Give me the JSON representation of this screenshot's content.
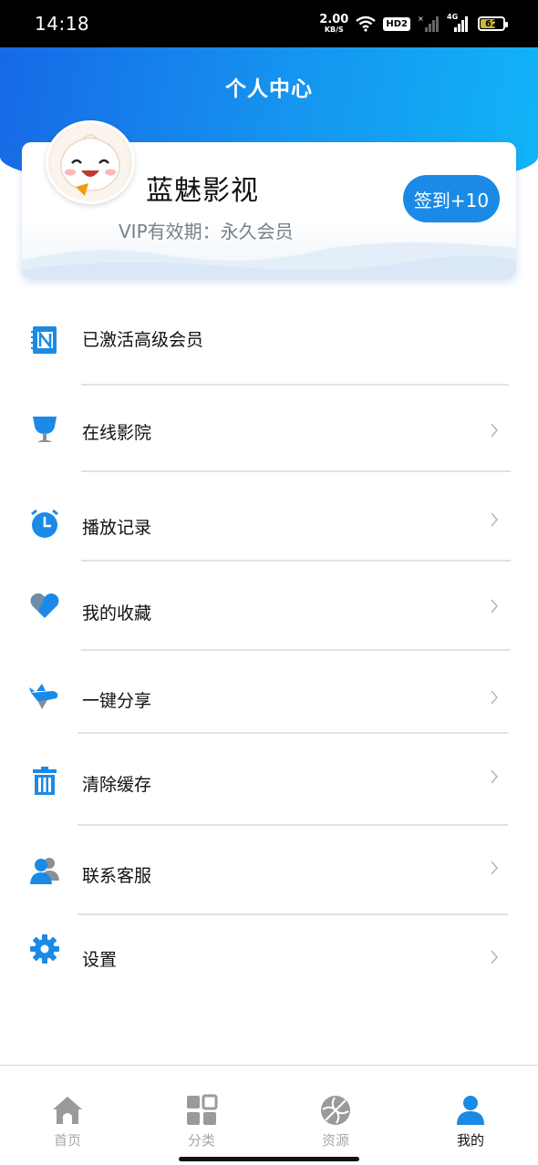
{
  "status_bar": {
    "time": "14:18",
    "net_speed": "2.00",
    "net_unit": "KB/S",
    "hd_label": "HD2",
    "network_type": "4G",
    "battery_level": "62"
  },
  "header": {
    "title": "个人中心",
    "accent_color": "#1b8ae6"
  },
  "profile": {
    "username": "蓝魅影视",
    "vip_text": "VIP有效期：永久会员",
    "signin_label": "签到+10"
  },
  "menu": {
    "items": [
      {
        "label": "已激活高级会员",
        "icon": "notebook-n-icon"
      },
      {
        "label": "在线影院",
        "icon": "trophy-cup-icon"
      },
      {
        "label": "播放记录",
        "icon": "alarm-clock-icon"
      },
      {
        "label": "我的收藏",
        "icon": "heart-icon"
      },
      {
        "label": "一键分享",
        "icon": "airplane-share-icon"
      },
      {
        "label": "清除缓存",
        "icon": "trash-icon"
      },
      {
        "label": "联系客服",
        "icon": "users-icon"
      },
      {
        "label": "设置",
        "icon": "gear-icon"
      }
    ]
  },
  "bottom_nav": {
    "items": [
      {
        "label": "首页",
        "icon": "home-icon"
      },
      {
        "label": "分类",
        "icon": "grid-icon"
      },
      {
        "label": "资源",
        "icon": "ball-icon"
      },
      {
        "label": "我的",
        "icon": "person-icon"
      }
    ],
    "active": "我的"
  }
}
